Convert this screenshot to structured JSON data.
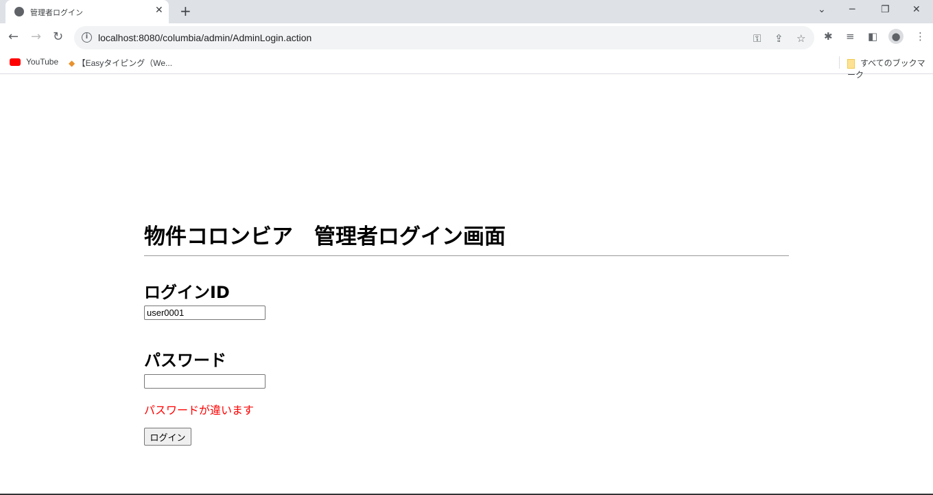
{
  "browser": {
    "tab_title": "管理者ログイン",
    "url": "localhost:8080/columbia/admin/AdminLogin.action",
    "bookmarks": [
      {
        "label": "YouTube"
      },
      {
        "label": "【Easyタイピング（We..."
      }
    ],
    "all_bookmarks": "すべてのブックマーク"
  },
  "page": {
    "title": "物件コロンビア　管理者ログイン画面",
    "login_id_label": "ログインID",
    "login_id_value": "user0001",
    "password_label": "パスワード",
    "password_value": "",
    "error_message": "パスワードが違います",
    "error_color": "#ff0000",
    "login_button": "ログイン"
  }
}
